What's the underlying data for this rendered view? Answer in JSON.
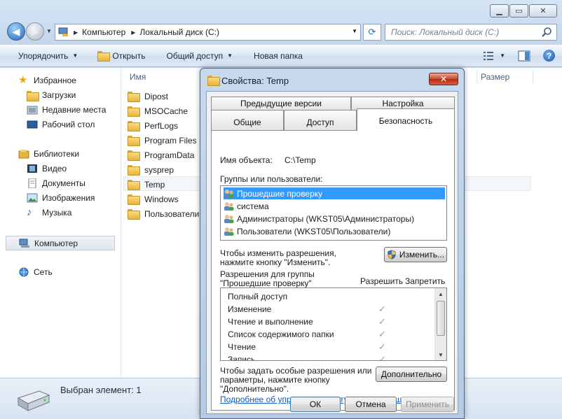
{
  "explorer": {
    "address": {
      "crumbs": [
        "Компьютер",
        "Локальный диск (C:)"
      ]
    },
    "search_placeholder": "Поиск: Локальный диск (C:)",
    "toolbar": {
      "organize": "Упорядочить",
      "open": "Открыть",
      "share": "Общий доступ",
      "new_folder": "Новая папка"
    },
    "sidebar": {
      "favorites": "Избранное",
      "downloads": "Загрузки",
      "recent": "Недавние места",
      "desktop": "Рабочий стол",
      "libraries": "Библиотеки",
      "video": "Видео",
      "documents": "Документы",
      "images": "Изображения",
      "music": "Музыка",
      "computer": "Компьютер",
      "network": "Сеть"
    },
    "columns": {
      "name": "Имя",
      "size": "Размер"
    },
    "files": [
      "Dipost",
      "MSOCache",
      "PerfLogs",
      "Program Files",
      "ProgramData",
      "sysprep",
      "Temp",
      "Windows",
      "Пользователи"
    ],
    "status": "Выбран элемент: 1"
  },
  "dialog": {
    "title": "Свойства: Temp",
    "tabs": {
      "previous_versions": "Предыдущие версии",
      "customize": "Настройка",
      "general": "Общие",
      "sharing": "Доступ",
      "security": "Безопасность"
    },
    "object_label": "Имя объекта:",
    "object_value": "C:\\Temp",
    "groups_label": "Группы или пользователи:",
    "groups": [
      "Прошедшие проверку",
      "система",
      "Администраторы (WKST05\\Администраторы)",
      "Пользователи (WKST05\\Пользователи)"
    ],
    "change_hint_1": "Чтобы изменить разрешения,",
    "change_hint_2": "нажмите кнопку \"Изменить\".",
    "change_button": "Изменить...",
    "perm_for_1": "Разрешения для группы",
    "perm_for_2": "\"Прошедшие проверку\"",
    "allow": "Разрешить",
    "deny": "Запретить",
    "permissions": [
      "Полный доступ",
      "Изменение",
      "Чтение и выполнение",
      "Список содержимого папки",
      "Чтение",
      "Запись"
    ],
    "advanced_hint_1": "Чтобы задать особые разрешения или",
    "advanced_hint_2": "параметры, нажмите кнопку",
    "advanced_hint_3": "\"Дополнительно\".",
    "advanced_button": "Дополнительно",
    "link": "Подробнее об управлении доступом и разрешениях",
    "ok": "ОК",
    "cancel": "Отмена",
    "apply": "Применить"
  }
}
